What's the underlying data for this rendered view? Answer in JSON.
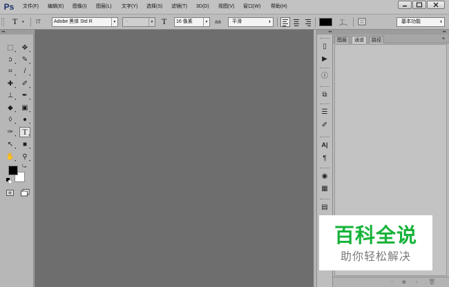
{
  "app": {
    "logo": "Ps"
  },
  "menubar": {
    "items": [
      "文件(F)",
      "编辑(E)",
      "图像(I)",
      "图层(L)",
      "文字(Y)",
      "选择(S)",
      "滤镜(T)",
      "3D(D)",
      "视图(V)",
      "窗口(W)",
      "帮助(H)"
    ],
    "window_controls": [
      "minimize-icon",
      "maximize-icon",
      "close-icon"
    ]
  },
  "options": {
    "tool_icon": "T",
    "orient_icon": "IT",
    "font_family": "Adobe 黑体 Std R",
    "font_style": "-",
    "size_icon": "T",
    "font_size": "16 像素",
    "aa_icon": "aa",
    "antialias": "平滑",
    "text_color": "#000000",
    "workspace": "基本功能"
  },
  "toolbox": {
    "grip": "◂◂",
    "tools": [
      {
        "name": "marquee-tool",
        "glyph": "⬚"
      },
      {
        "name": "move-tool",
        "glyph": "✥"
      },
      {
        "name": "lasso-tool",
        "glyph": "ↄ"
      },
      {
        "name": "magic-wand-tool",
        "glyph": "✎"
      },
      {
        "name": "crop-tool",
        "glyph": "⌗"
      },
      {
        "name": "eyedropper-tool",
        "glyph": "/"
      },
      {
        "name": "healing-tool",
        "glyph": "✚"
      },
      {
        "name": "brush-tool",
        "glyph": "✐"
      },
      {
        "name": "stamp-tool",
        "glyph": "⊥"
      },
      {
        "name": "history-brush-tool",
        "glyph": "✒"
      },
      {
        "name": "eraser-tool",
        "glyph": "◆"
      },
      {
        "name": "gradient-tool",
        "glyph": "▣"
      },
      {
        "name": "blur-tool",
        "glyph": "◊"
      },
      {
        "name": "dodge-tool",
        "glyph": "●"
      },
      {
        "name": "pen-tool",
        "glyph": "✑"
      },
      {
        "name": "type-tool",
        "glyph": "T"
      },
      {
        "name": "path-select-tool",
        "glyph": "↖"
      },
      {
        "name": "shape-tool",
        "glyph": "■"
      },
      {
        "name": "hand-tool",
        "glyph": "✋"
      },
      {
        "name": "zoom-tool",
        "glyph": "⚲"
      }
    ],
    "foreground_color": "#000000",
    "background_color": "#ffffff"
  },
  "dock": {
    "grip": "◂◂",
    "buttons": [
      {
        "name": "history-panel-icon",
        "glyph": "▯"
      },
      {
        "name": "actions-panel-icon",
        "glyph": "▶"
      },
      {
        "name": "info-panel-icon",
        "glyph": "ⓘ"
      },
      {
        "name": "layer-comps-icon",
        "glyph": "⧉"
      },
      {
        "name": "adjustments-icon",
        "glyph": "☰"
      },
      {
        "name": "brush-presets-icon",
        "glyph": "✐"
      },
      {
        "name": "character-panel-icon",
        "glyph": "A|"
      },
      {
        "name": "paragraph-panel-icon",
        "glyph": "¶"
      },
      {
        "name": "color-panel-icon",
        "glyph": "◉"
      },
      {
        "name": "swatches-panel-icon",
        "glyph": "▦"
      },
      {
        "name": "notes-panel-icon",
        "glyph": "▤"
      }
    ]
  },
  "panel": {
    "grip": "▸▸",
    "tabs": [
      "图层",
      "通道",
      "路径"
    ],
    "active_tab": 1,
    "menu": "≡",
    "footer_icons": [
      "load-selection-icon",
      "mask-icon",
      "new-channel-icon",
      "delete-icon"
    ]
  },
  "watermark": {
    "title": "百科全说",
    "subtitle": "助你轻松解决",
    "color": "#17b33a"
  }
}
